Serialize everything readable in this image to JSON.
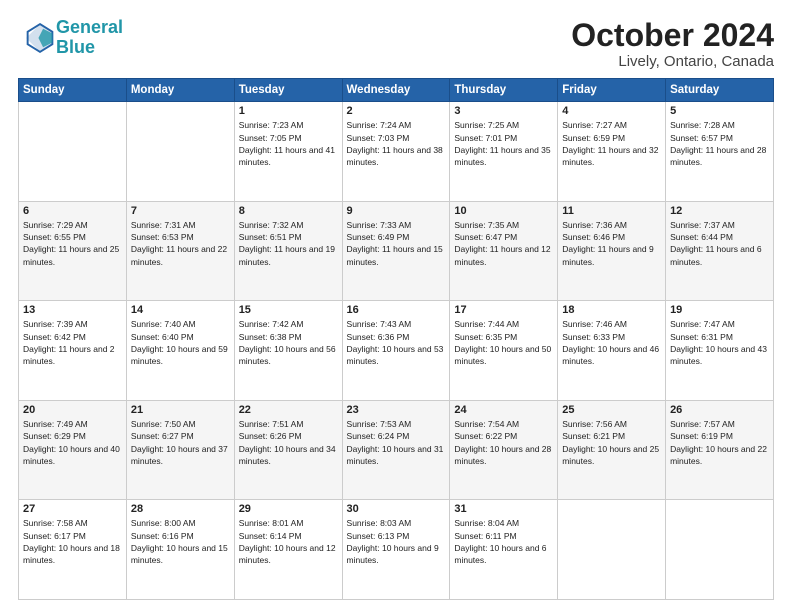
{
  "header": {
    "logo_line1": "General",
    "logo_line2": "Blue",
    "month_title": "October 2024",
    "location": "Lively, Ontario, Canada"
  },
  "days_of_week": [
    "Sunday",
    "Monday",
    "Tuesday",
    "Wednesday",
    "Thursday",
    "Friday",
    "Saturday"
  ],
  "weeks": [
    [
      {
        "day": "",
        "info": ""
      },
      {
        "day": "",
        "info": ""
      },
      {
        "day": "1",
        "info": "Sunrise: 7:23 AM\nSunset: 7:05 PM\nDaylight: 11 hours and 41 minutes."
      },
      {
        "day": "2",
        "info": "Sunrise: 7:24 AM\nSunset: 7:03 PM\nDaylight: 11 hours and 38 minutes."
      },
      {
        "day": "3",
        "info": "Sunrise: 7:25 AM\nSunset: 7:01 PM\nDaylight: 11 hours and 35 minutes."
      },
      {
        "day": "4",
        "info": "Sunrise: 7:27 AM\nSunset: 6:59 PM\nDaylight: 11 hours and 32 minutes."
      },
      {
        "day": "5",
        "info": "Sunrise: 7:28 AM\nSunset: 6:57 PM\nDaylight: 11 hours and 28 minutes."
      }
    ],
    [
      {
        "day": "6",
        "info": "Sunrise: 7:29 AM\nSunset: 6:55 PM\nDaylight: 11 hours and 25 minutes."
      },
      {
        "day": "7",
        "info": "Sunrise: 7:31 AM\nSunset: 6:53 PM\nDaylight: 11 hours and 22 minutes."
      },
      {
        "day": "8",
        "info": "Sunrise: 7:32 AM\nSunset: 6:51 PM\nDaylight: 11 hours and 19 minutes."
      },
      {
        "day": "9",
        "info": "Sunrise: 7:33 AM\nSunset: 6:49 PM\nDaylight: 11 hours and 15 minutes."
      },
      {
        "day": "10",
        "info": "Sunrise: 7:35 AM\nSunset: 6:47 PM\nDaylight: 11 hours and 12 minutes."
      },
      {
        "day": "11",
        "info": "Sunrise: 7:36 AM\nSunset: 6:46 PM\nDaylight: 11 hours and 9 minutes."
      },
      {
        "day": "12",
        "info": "Sunrise: 7:37 AM\nSunset: 6:44 PM\nDaylight: 11 hours and 6 minutes."
      }
    ],
    [
      {
        "day": "13",
        "info": "Sunrise: 7:39 AM\nSunset: 6:42 PM\nDaylight: 11 hours and 2 minutes."
      },
      {
        "day": "14",
        "info": "Sunrise: 7:40 AM\nSunset: 6:40 PM\nDaylight: 10 hours and 59 minutes."
      },
      {
        "day": "15",
        "info": "Sunrise: 7:42 AM\nSunset: 6:38 PM\nDaylight: 10 hours and 56 minutes."
      },
      {
        "day": "16",
        "info": "Sunrise: 7:43 AM\nSunset: 6:36 PM\nDaylight: 10 hours and 53 minutes."
      },
      {
        "day": "17",
        "info": "Sunrise: 7:44 AM\nSunset: 6:35 PM\nDaylight: 10 hours and 50 minutes."
      },
      {
        "day": "18",
        "info": "Sunrise: 7:46 AM\nSunset: 6:33 PM\nDaylight: 10 hours and 46 minutes."
      },
      {
        "day": "19",
        "info": "Sunrise: 7:47 AM\nSunset: 6:31 PM\nDaylight: 10 hours and 43 minutes."
      }
    ],
    [
      {
        "day": "20",
        "info": "Sunrise: 7:49 AM\nSunset: 6:29 PM\nDaylight: 10 hours and 40 minutes."
      },
      {
        "day": "21",
        "info": "Sunrise: 7:50 AM\nSunset: 6:27 PM\nDaylight: 10 hours and 37 minutes."
      },
      {
        "day": "22",
        "info": "Sunrise: 7:51 AM\nSunset: 6:26 PM\nDaylight: 10 hours and 34 minutes."
      },
      {
        "day": "23",
        "info": "Sunrise: 7:53 AM\nSunset: 6:24 PM\nDaylight: 10 hours and 31 minutes."
      },
      {
        "day": "24",
        "info": "Sunrise: 7:54 AM\nSunset: 6:22 PM\nDaylight: 10 hours and 28 minutes."
      },
      {
        "day": "25",
        "info": "Sunrise: 7:56 AM\nSunset: 6:21 PM\nDaylight: 10 hours and 25 minutes."
      },
      {
        "day": "26",
        "info": "Sunrise: 7:57 AM\nSunset: 6:19 PM\nDaylight: 10 hours and 22 minutes."
      }
    ],
    [
      {
        "day": "27",
        "info": "Sunrise: 7:58 AM\nSunset: 6:17 PM\nDaylight: 10 hours and 18 minutes."
      },
      {
        "day": "28",
        "info": "Sunrise: 8:00 AM\nSunset: 6:16 PM\nDaylight: 10 hours and 15 minutes."
      },
      {
        "day": "29",
        "info": "Sunrise: 8:01 AM\nSunset: 6:14 PM\nDaylight: 10 hours and 12 minutes."
      },
      {
        "day": "30",
        "info": "Sunrise: 8:03 AM\nSunset: 6:13 PM\nDaylight: 10 hours and 9 minutes."
      },
      {
        "day": "31",
        "info": "Sunrise: 8:04 AM\nSunset: 6:11 PM\nDaylight: 10 hours and 6 minutes."
      },
      {
        "day": "",
        "info": ""
      },
      {
        "day": "",
        "info": ""
      }
    ]
  ]
}
